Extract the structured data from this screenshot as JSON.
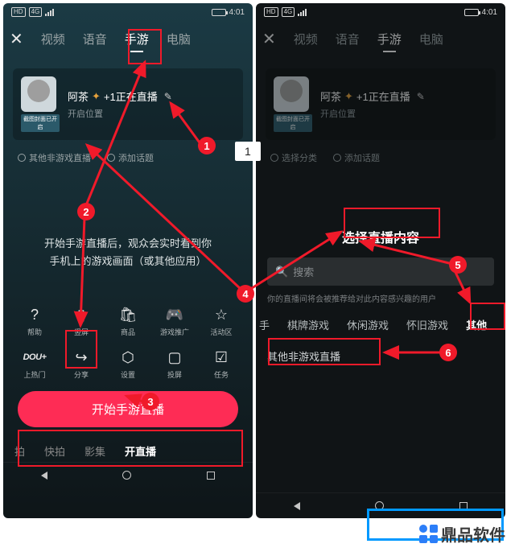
{
  "status": {
    "hd": "HD",
    "net": "4G",
    "vol": "⋮",
    "time": "4:01"
  },
  "left": {
    "tabs": {
      "video": "视频",
      "voice": "语音",
      "mobile": "手游",
      "pc": "电脑"
    },
    "card": {
      "avatar_tag": "截图封面已开启",
      "title_pre": "阿茶",
      "title_leaf": "✦",
      "title_post": "+1正在直播",
      "sub": "开启位置"
    },
    "tags": {
      "cat": "其他非游戏直播",
      "topic": "添加话题"
    },
    "desc": "开始手游直播后，观众会实时看到你\n手机上的游戏画面（或其他应用）",
    "row1": {
      "help": "帮助",
      "portrait": "竖屏",
      "shop": "商品",
      "promote": "游戏推广",
      "zone": "活动区"
    },
    "row2": {
      "dou": "DOU+",
      "hot": "上热门",
      "share": "分享",
      "setting": "设置",
      "cast": "投屏",
      "task": "任务"
    },
    "start": "开始手游直播",
    "bottom": {
      "pai": "拍",
      "kuai": "快拍",
      "film": "影集",
      "live": "开直播"
    }
  },
  "right": {
    "tabs": {
      "video": "视频",
      "voice": "语音",
      "mobile": "手游",
      "pc": "电脑"
    },
    "card": {
      "avatar_tag": "截图封面已开启",
      "title_pre": "阿茶",
      "title_leaf": "✦",
      "title_post": "+1正在直播",
      "sub": "开启位置"
    },
    "tags": {
      "cat": "选择分类",
      "topic": "添加话题"
    },
    "title": "选择直播内容",
    "search": "搜索",
    "hint": "你的直播间将会被推荐给对此内容感兴趣的用户",
    "cats": {
      "c0": "手",
      "c1": "棋牌游戏",
      "c2": "休闲游戏",
      "c3": "怀旧游戏",
      "c4": "其他"
    },
    "other": "其他非游戏直播"
  },
  "ann": {
    "n1": "1",
    "n2": "2",
    "n3": "3",
    "n4": "4",
    "n5": "5",
    "n6": "6",
    "pill": "1"
  },
  "brand": "鼎品软件"
}
